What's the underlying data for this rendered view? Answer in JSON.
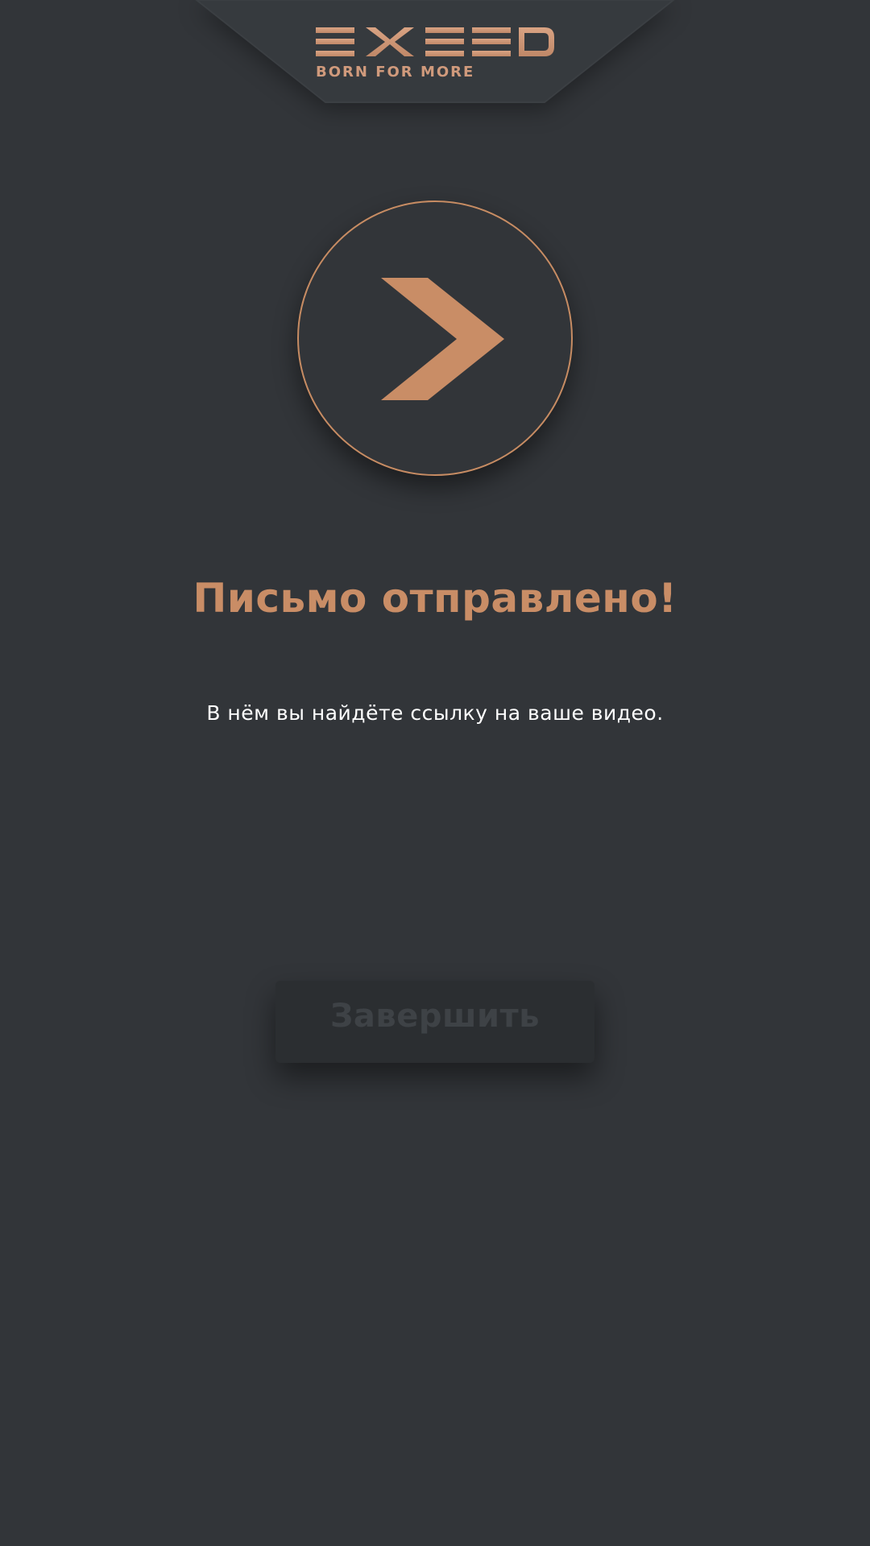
{
  "header": {
    "brand": "EXEED",
    "tagline": "BORN FOR MORE"
  },
  "icon": "chevron-right-icon",
  "main": {
    "title": "Письмо отправлено!",
    "subtitle": "В нём вы найдёте ссылку на ваше видео."
  },
  "actions": {
    "finish_label": "Завершить"
  },
  "colors": {
    "background": "#323539",
    "accent": "#c98d66",
    "button_bg": "#2b2e31",
    "button_text": "#3e4246",
    "text": "#ffffff"
  }
}
